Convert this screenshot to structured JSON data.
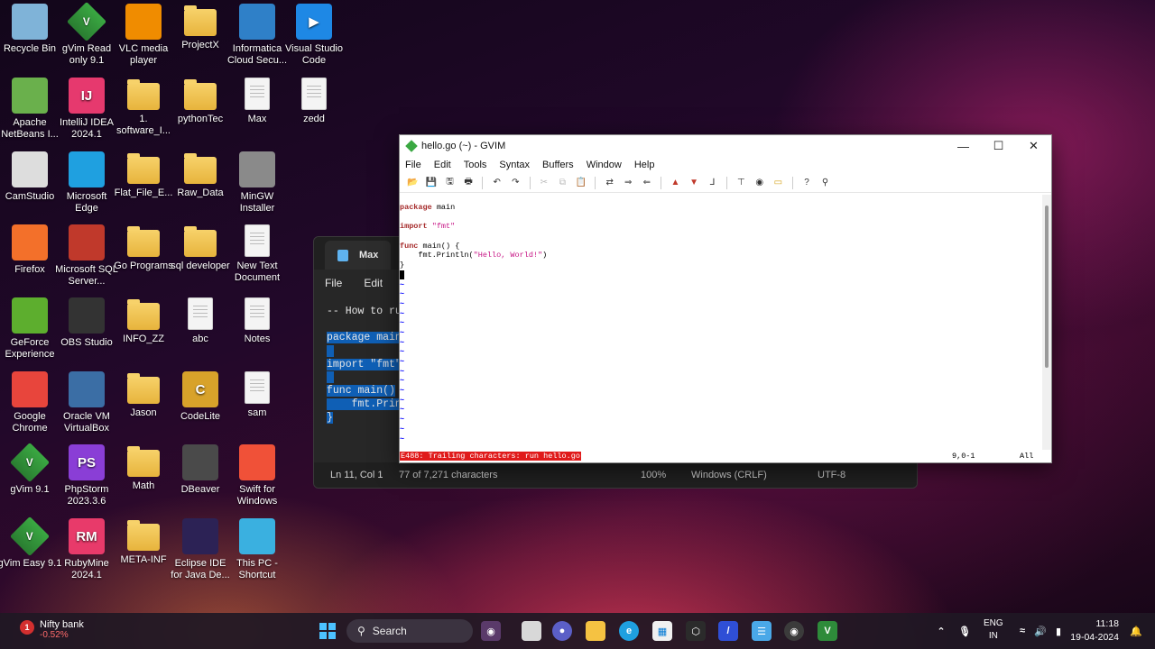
{
  "desktop": {
    "icons": [
      {
        "label": "Recycle Bin",
        "icon": "recycle-bin-icon"
      },
      {
        "label": "gVim Read only 9.1",
        "icon": "gvim-icon"
      },
      {
        "label": "VLC media player",
        "icon": "vlc-icon"
      },
      {
        "label": "ProjectX",
        "icon": "folder-icon"
      },
      {
        "label": "Informatica Cloud Secu...",
        "icon": "informatica-icon"
      },
      {
        "label": "Visual Studio Code",
        "icon": "vscode-icon"
      },
      {
        "label": "Apache NetBeans I...",
        "icon": "netbeans-icon"
      },
      {
        "label": "IntelliJ IDEA 2024.1",
        "icon": "intellij-icon"
      },
      {
        "label": "1. software_I...",
        "icon": "folder-icon"
      },
      {
        "label": "pythonTec",
        "icon": "folder-icon"
      },
      {
        "label": "Max",
        "icon": "text-file-icon"
      },
      {
        "label": "zedd",
        "icon": "text-file-icon"
      },
      {
        "label": "CamStudio",
        "icon": "camstudio-icon"
      },
      {
        "label": "Microsoft Edge",
        "icon": "edge-icon"
      },
      {
        "label": "Flat_File_E...",
        "icon": "folder-icon"
      },
      {
        "label": "Raw_Data",
        "icon": "folder-icon"
      },
      {
        "label": "MinGW Installer",
        "icon": "mingw-icon"
      },
      {
        "label": "Firefox",
        "icon": "firefox-icon"
      },
      {
        "label": "Microsoft SQL Server...",
        "icon": "sql-server-icon"
      },
      {
        "label": "Go Programs",
        "icon": "folder-icon"
      },
      {
        "label": "sql developer",
        "icon": "folder-icon"
      },
      {
        "label": "New Text Document",
        "icon": "text-file-icon"
      },
      {
        "label": "GeForce Experience",
        "icon": "geforce-icon"
      },
      {
        "label": "OBS Studio",
        "icon": "obs-icon"
      },
      {
        "label": "INFO_ZZ",
        "icon": "folder-icon"
      },
      {
        "label": "abc",
        "icon": "text-file-icon"
      },
      {
        "label": "Notes",
        "icon": "text-file-icon"
      },
      {
        "label": "Google Chrome",
        "icon": "chrome-icon"
      },
      {
        "label": "Oracle VM VirtualBox",
        "icon": "virtualbox-icon"
      },
      {
        "label": "Jason",
        "icon": "folder-icon"
      },
      {
        "label": "CodeLite",
        "icon": "codelite-icon"
      },
      {
        "label": "sam",
        "icon": "text-file-icon"
      },
      {
        "label": "gVim 9.1",
        "icon": "gvim-icon"
      },
      {
        "label": "PhpStorm 2023.3.6",
        "icon": "phpstorm-icon"
      },
      {
        "label": "Math",
        "icon": "folder-icon"
      },
      {
        "label": "DBeaver",
        "icon": "dbeaver-icon"
      },
      {
        "label": "Swift for Windows",
        "icon": "swift-icon"
      },
      {
        "label": "gVim Easy 9.1",
        "icon": "gvim-icon"
      },
      {
        "label": "RubyMine 2024.1",
        "icon": "rubymine-icon"
      },
      {
        "label": "META-INF",
        "icon": "folder-icon"
      },
      {
        "label": "Eclipse IDE for Java De...",
        "icon": "eclipse-icon"
      },
      {
        "label": "This PC - Shortcut",
        "icon": "this-pc-icon"
      }
    ]
  },
  "notepad": {
    "tab_title": "Max",
    "menu": [
      "File",
      "Edit"
    ],
    "lines": [
      "-- How to ru",
      "",
      "package main",
      "",
      "import \"fmt\"",
      "",
      "func main()",
      "    fmt.Prin",
      "}"
    ],
    "status": {
      "position": "Ln 11, Col 1",
      "chars": "77 of 7,271 characters",
      "zoom": "100%",
      "eol": "Windows (CRLF)",
      "encoding": "UTF-8"
    }
  },
  "gvim": {
    "title": "hello.go (~) - GVIM",
    "menu": [
      "File",
      "Edit",
      "Tools",
      "Syntax",
      "Buffers",
      "Window",
      "Help"
    ],
    "code": {
      "l1_kw": "package",
      "l1_rest": " main",
      "l3_kw": "import",
      "l3_str": "\"fmt\"",
      "l5_kw": "func",
      "l5_rest": " main() {",
      "l6_pre": "    fmt.Println(",
      "l6_str": "\"Hello, World!\"",
      "l6_post": ")",
      "l7": "}"
    },
    "tilde": "~",
    "error_msg": "E488: Trailing characters: run hello.go",
    "cursor_pos": "9,0-1",
    "scroll_pos": "All"
  },
  "taskbar": {
    "widget_badge": "1",
    "widget_title": "Nifty bank",
    "widget_change": "-0.52%",
    "search_label": "Search",
    "lang_line1": "ENG",
    "lang_line2": "IN",
    "time": "11:18",
    "date": "19-04-2024"
  },
  "colors": {
    "vim_error_bg": "#e01b1b",
    "vim_keyword": "#a52a2a",
    "vim_string": "#c71585",
    "notepad_selection": "#0f5fb5"
  }
}
